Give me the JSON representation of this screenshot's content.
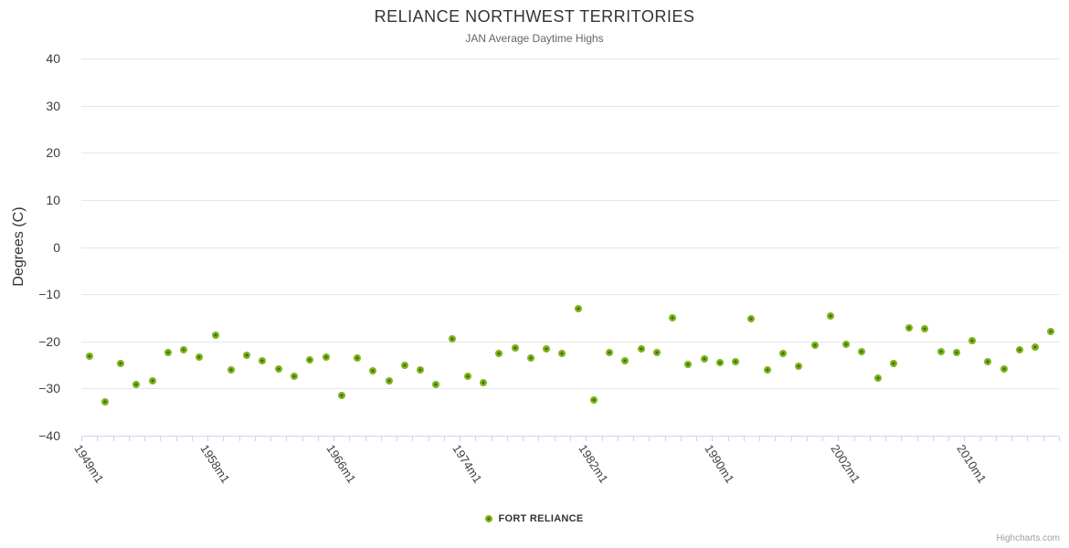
{
  "chart": {
    "title": "RELIANCE NORTHWEST TERRITORIES",
    "subtitle": "JAN Average Daytime Highs",
    "y_axis_title": "Degrees (C)",
    "legend": {
      "label": "FORT RELIANCE"
    },
    "credits": "Highcharts.com"
  },
  "colors": {
    "marker": "#7cb51d",
    "marker_center": "#41700a",
    "gridline": "#e6e6e6",
    "axis_line": "#ccd6eb",
    "title": "#333333",
    "subtitle": "#666666",
    "axis_labels": "#3d3d3d",
    "credits": "#9e9e9e"
  },
  "chart_data": {
    "type": "scatter",
    "title": "RELIANCE NORTHWEST TERRITORIES",
    "subtitle": "JAN Average Daytime Highs",
    "xlabel": "",
    "ylabel": "Degrees (C)",
    "ylim": [
      -40,
      40
    ],
    "y_ticks": [
      40,
      30,
      20,
      10,
      0,
      -10,
      -20,
      -30,
      -40
    ],
    "grid": "horizontal",
    "legend_position": "bottom-center",
    "n_points": 62,
    "x_ticks": [
      {
        "index": 0,
        "label": "1949m1"
      },
      {
        "index": 8,
        "label": "1958m1"
      },
      {
        "index": 16,
        "label": "1966m1"
      },
      {
        "index": 24,
        "label": "1974m1"
      },
      {
        "index": 32,
        "label": "1982m1"
      },
      {
        "index": 40,
        "label": "1990m1"
      },
      {
        "index": 48,
        "label": "2002m1"
      },
      {
        "index": 56,
        "label": "2010m1"
      }
    ],
    "series": [
      {
        "name": "FORT RELIANCE",
        "color": "#7cb51d",
        "values": [
          -23.2,
          -32.9,
          -24.7,
          -29.2,
          -28.4,
          -22.3,
          -21.7,
          -23.4,
          -18.7,
          -26.1,
          -23.0,
          -24.2,
          -25.8,
          -27.4,
          -23.9,
          -23.3,
          -31.4,
          -23.5,
          -26.3,
          -28.3,
          -25.0,
          -26.0,
          -29.2,
          -19.5,
          -27.5,
          -28.8,
          -22.6,
          -21.4,
          -23.5,
          -21.6,
          -22.6,
          -13.1,
          -32.4,
          -22.3,
          -24.2,
          -21.6,
          -22.4,
          -15.1,
          -24.8,
          -23.7,
          -24.6,
          -24.4,
          -15.2,
          -26.1,
          -22.6,
          -25.2,
          -20.8,
          -14.6,
          -20.6,
          -22.2,
          -27.7,
          -24.7,
          -17.1,
          -17.3,
          -22.1,
          -22.3,
          -19.8,
          -24.4,
          -25.8,
          -21.8,
          -21.2,
          -17.9
        ]
      }
    ]
  }
}
